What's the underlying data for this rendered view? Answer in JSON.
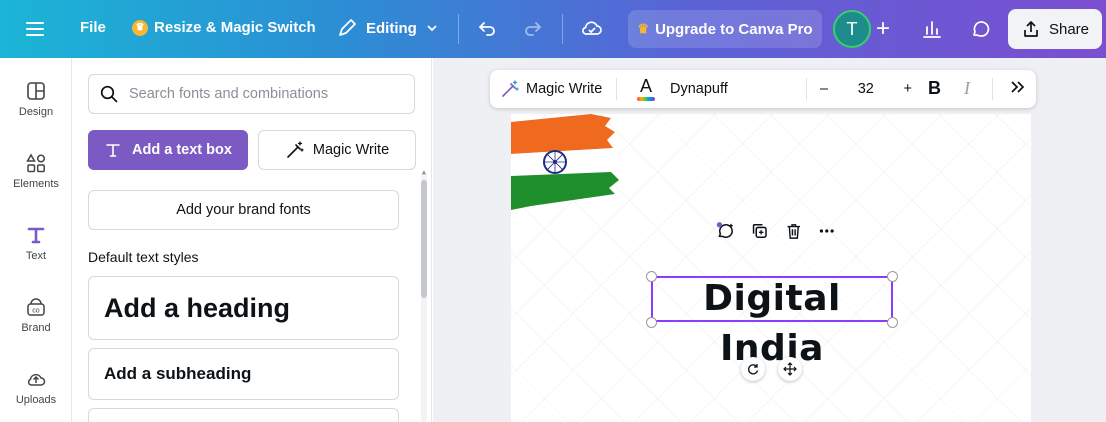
{
  "topbar": {
    "file_label": "File",
    "resize_label": "Resize & Magic Switch",
    "editing_label": "Editing",
    "upgrade_label": "Upgrade to Canva Pro",
    "avatar_initial": "T",
    "share_label": "Share",
    "colors": {
      "gradient_start": "#1bb5d6",
      "gradient_end": "#7b4fd0",
      "avatar_bg": "#1f8c8c",
      "avatar_ring": "#35d06a"
    }
  },
  "rail": {
    "items": [
      {
        "label": "Design",
        "icon": "layout-icon"
      },
      {
        "label": "Elements",
        "icon": "shapes-icon"
      },
      {
        "label": "Text",
        "icon": "text-t-icon"
      },
      {
        "label": "Brand",
        "icon": "brand-icon"
      },
      {
        "label": "Uploads",
        "icon": "cloud-upload-icon"
      }
    ]
  },
  "panel": {
    "search_placeholder": "Search fonts and combinations",
    "add_textbox_label": "Add a text box",
    "magic_write_label": "Magic Write",
    "brand_fonts_label": "Add your brand fonts",
    "default_styles_label": "Default text styles",
    "heading_label": "Add a heading",
    "subheading_label": "Add a subheading",
    "accent": "#7c5ac4"
  },
  "toolbar": {
    "magic_write_label": "Magic Write",
    "font_name": "Dynapuff",
    "font_size": "32",
    "decrease_label": "–",
    "increase_label": "+",
    "bold_label": "B",
    "italic_label": "I"
  },
  "canvas": {
    "selected_text": "Digital India",
    "selection_color": "#8b3dff"
  }
}
